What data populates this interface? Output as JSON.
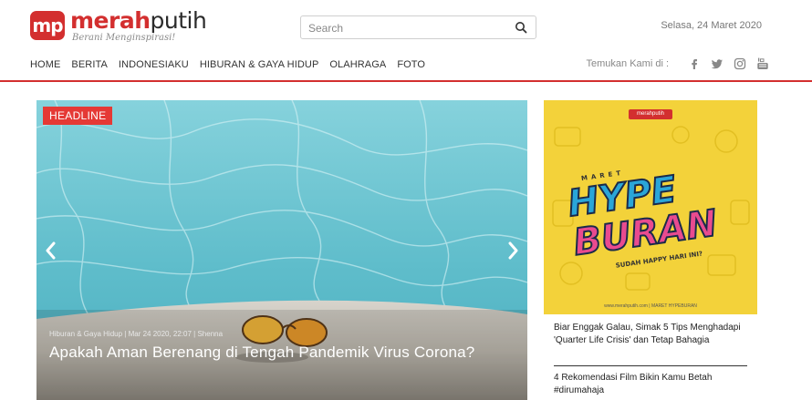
{
  "brand": {
    "mark": "mp",
    "name_red": "merah",
    "name_dark": "putih",
    "tagline": "Berani Menginspirasi!"
  },
  "search": {
    "placeholder": "Search",
    "icon": "search-icon"
  },
  "date": "Selasa, 24 Maret 2020",
  "nav": {
    "items": [
      "HOME",
      "BERITA",
      "INDONESIAKU",
      "HIBURAN & GAYA HIDUP",
      "OLAHRAGA",
      "FOTO"
    ]
  },
  "follow": {
    "label": "Temukan Kami di :",
    "icons": [
      "facebook-icon",
      "twitter-icon",
      "instagram-icon",
      "youtube-icon"
    ]
  },
  "colors": {
    "accent": "#d32f2f",
    "badge": "#e53935",
    "ad_bg": "#f3d23a"
  },
  "headline": {
    "badge": "HEADLINE",
    "meta": "Hiburan & Gaya Hidup | Mar 24 2020, 22:07 | Shenna",
    "title": "Apakah Aman Berenang di Tengah Pandemik Virus Corona?"
  },
  "ad": {
    "logo": "merahputih",
    "top": "MARET",
    "line1": "HYPE",
    "line2": "BURAN",
    "sub": "SUDAH HAPPY HARI INI?",
    "url": "www.merahputih.com | MARET HYPEBURAN"
  },
  "stories": [
    "Biar Enggak Galau, Simak 5 Tips Menghadapi 'Quarter Life Crisis' dan Tetap Bahagia",
    "4 Rekomendasi Film Bikin Kamu Betah #dirumahaja"
  ]
}
